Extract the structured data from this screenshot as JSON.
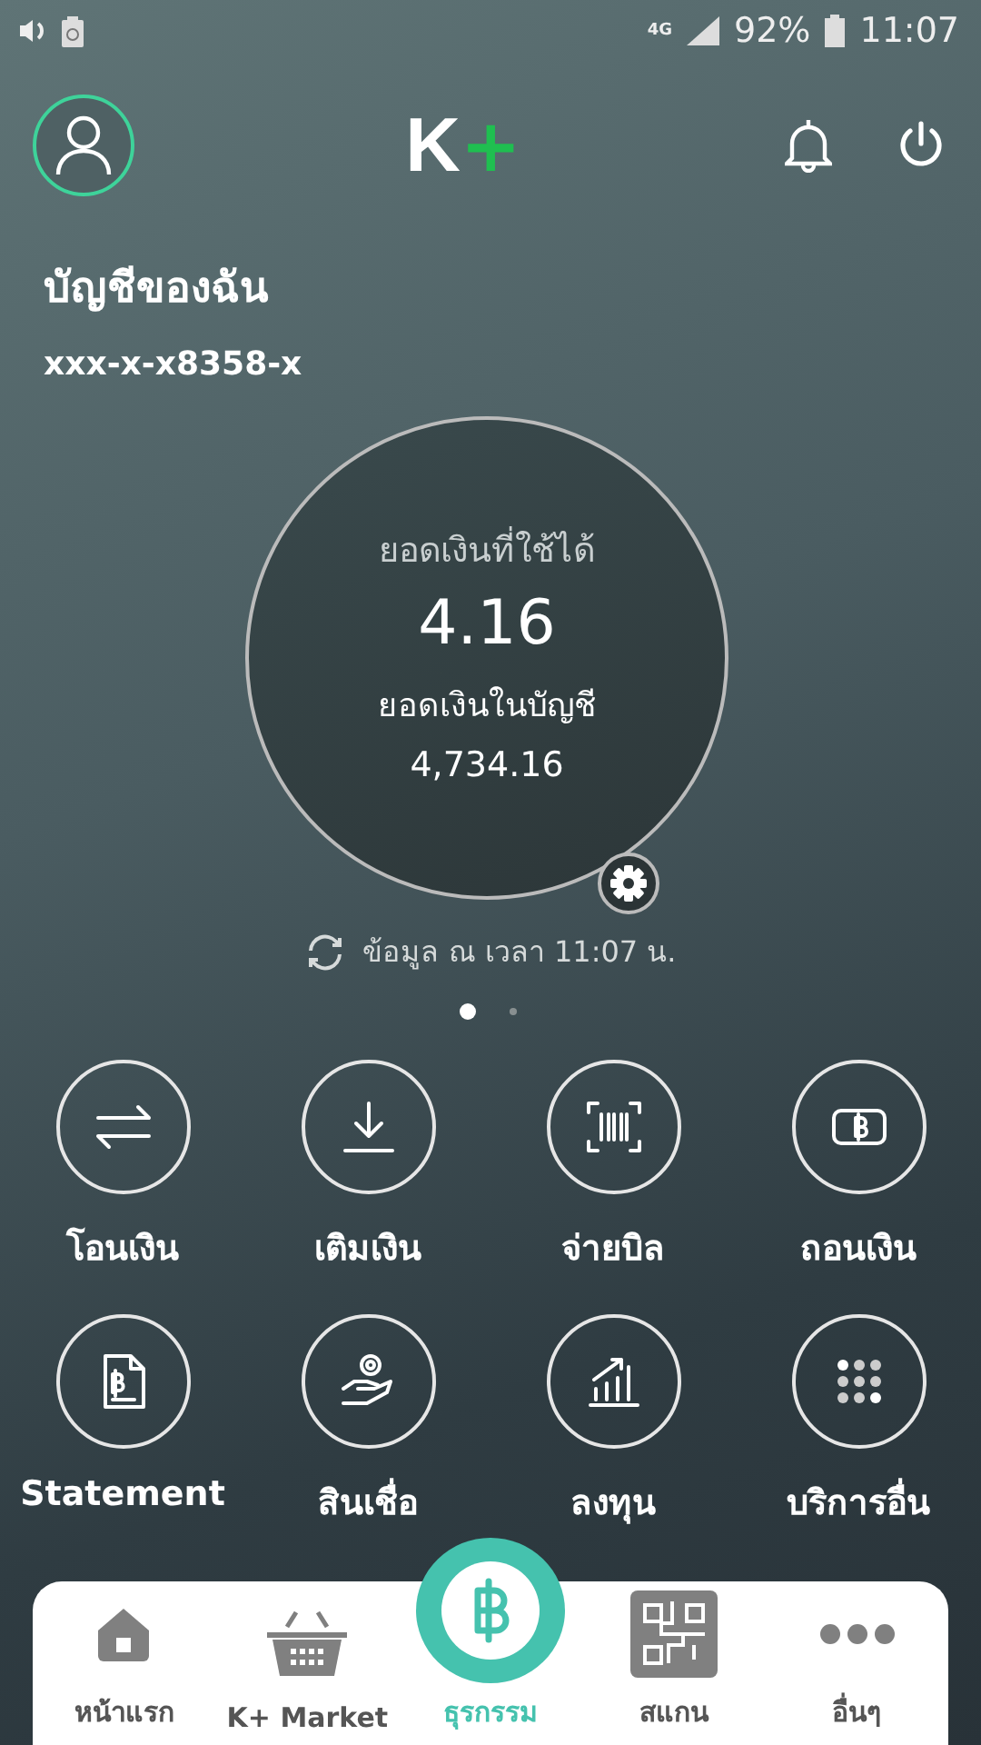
{
  "status_bar": {
    "network": "4G",
    "battery": "92%",
    "time": "11:07"
  },
  "header": {
    "logo_letter": "K",
    "logo_plus": "+"
  },
  "account": {
    "title": "บัญชีของฉัน",
    "number": "xxx-x-x8358-x"
  },
  "balance": {
    "available_label": "ยอดเงินที่ใช้ได้",
    "available": "4.16",
    "ledger_label": "ยอดเงินในบัญชี",
    "ledger": "4,734.16"
  },
  "updated": "ข้อมูล ณ เวลา 11:07 น.",
  "pager": [
    {
      "selected": true
    },
    {
      "selected": false
    }
  ],
  "actions": [
    {
      "kind": "transfer",
      "label": "โอนเงิน"
    },
    {
      "kind": "topup",
      "label": "เติมเงิน"
    },
    {
      "kind": "bill",
      "label": "จ่ายบิล"
    },
    {
      "kind": "withdraw",
      "label": "ถอนเงิน"
    },
    {
      "kind": "statement",
      "label": "Statement"
    },
    {
      "kind": "loan",
      "label": "สินเชื่อ"
    },
    {
      "kind": "invest",
      "label": "ลงทุน"
    },
    {
      "kind": "more",
      "label": "บริการอื่น"
    }
  ],
  "nav": [
    {
      "kind": "home",
      "label": "หน้าแรก",
      "selected": false
    },
    {
      "kind": "market",
      "label": "K+ Market",
      "selected": false
    },
    {
      "kind": "baht",
      "label": "ธุรกรรม",
      "selected": true
    },
    {
      "kind": "scan",
      "label": "สแกน",
      "selected": false
    },
    {
      "kind": "dots",
      "label": "อื่นๆ",
      "selected": false
    }
  ]
}
